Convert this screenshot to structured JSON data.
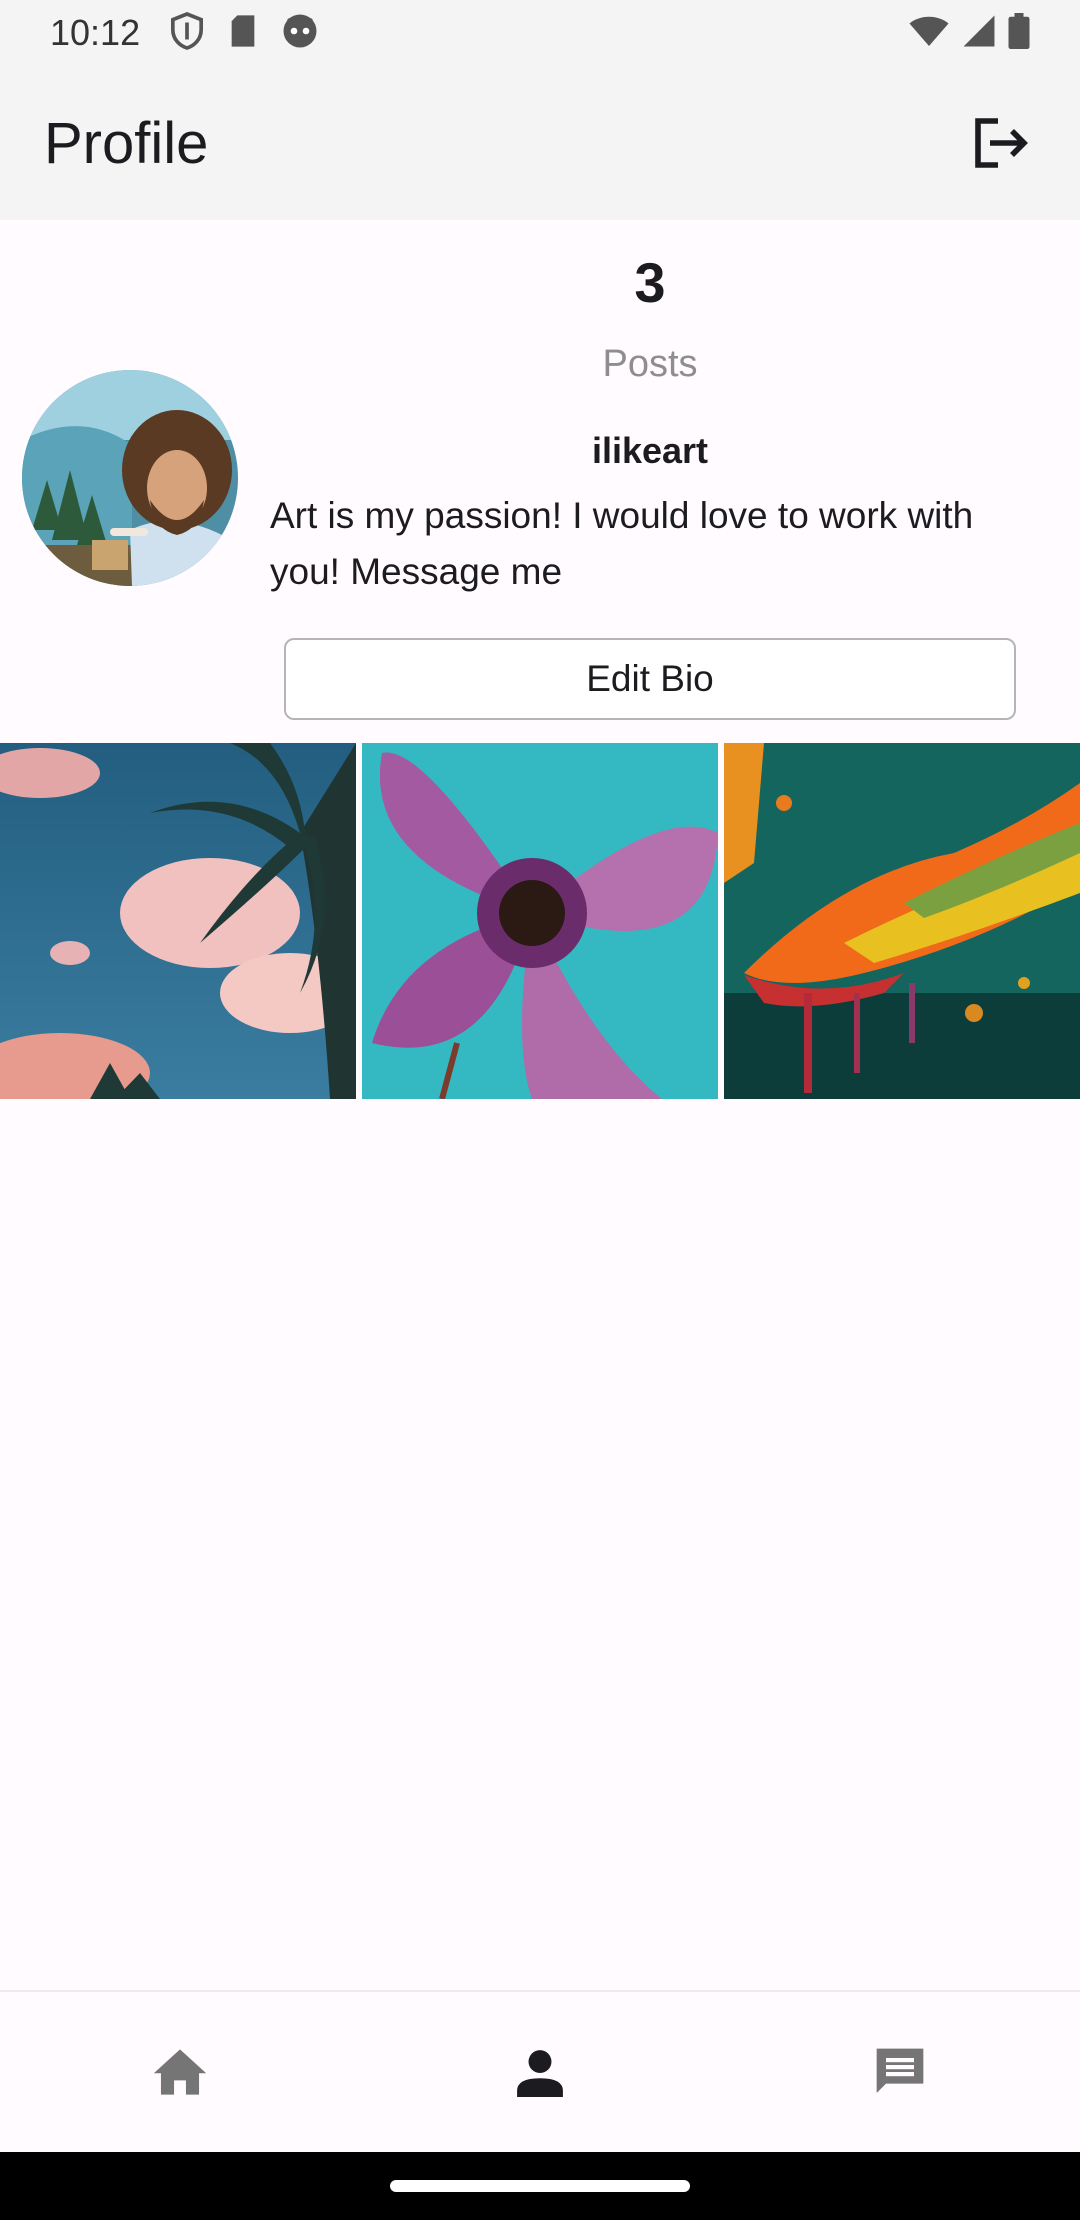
{
  "status_bar": {
    "time": "10:12",
    "icons_left": [
      "shield-icon",
      "sd-card-icon",
      "robot-icon"
    ],
    "icons_right": [
      "wifi-icon",
      "signal-icon",
      "battery-icon"
    ]
  },
  "app_bar": {
    "title": "Profile",
    "action_icon": "logout-icon"
  },
  "profile": {
    "posts_count": "3",
    "posts_label": "Posts",
    "username": "ilikeart",
    "bio": "Art is my passion! I would love to work with you! Message me",
    "edit_bio_label": "Edit Bio"
  },
  "posts": [
    {
      "subject": "palm trees against pink clouds"
    },
    {
      "subject": "purple flower close-up"
    },
    {
      "subject": "colorful paint splash"
    }
  ],
  "bottom_nav": {
    "items": [
      {
        "icon": "home-icon",
        "active": false
      },
      {
        "icon": "person-icon",
        "active": true
      },
      {
        "icon": "chat-icon",
        "active": false
      }
    ]
  },
  "colors": {
    "appbar_bg": "#f4f4f4",
    "page_bg": "#fffbfe",
    "muted_text": "#8e8e8e",
    "inactive_icon": "#757575",
    "active_icon": "#1c1b1f"
  }
}
